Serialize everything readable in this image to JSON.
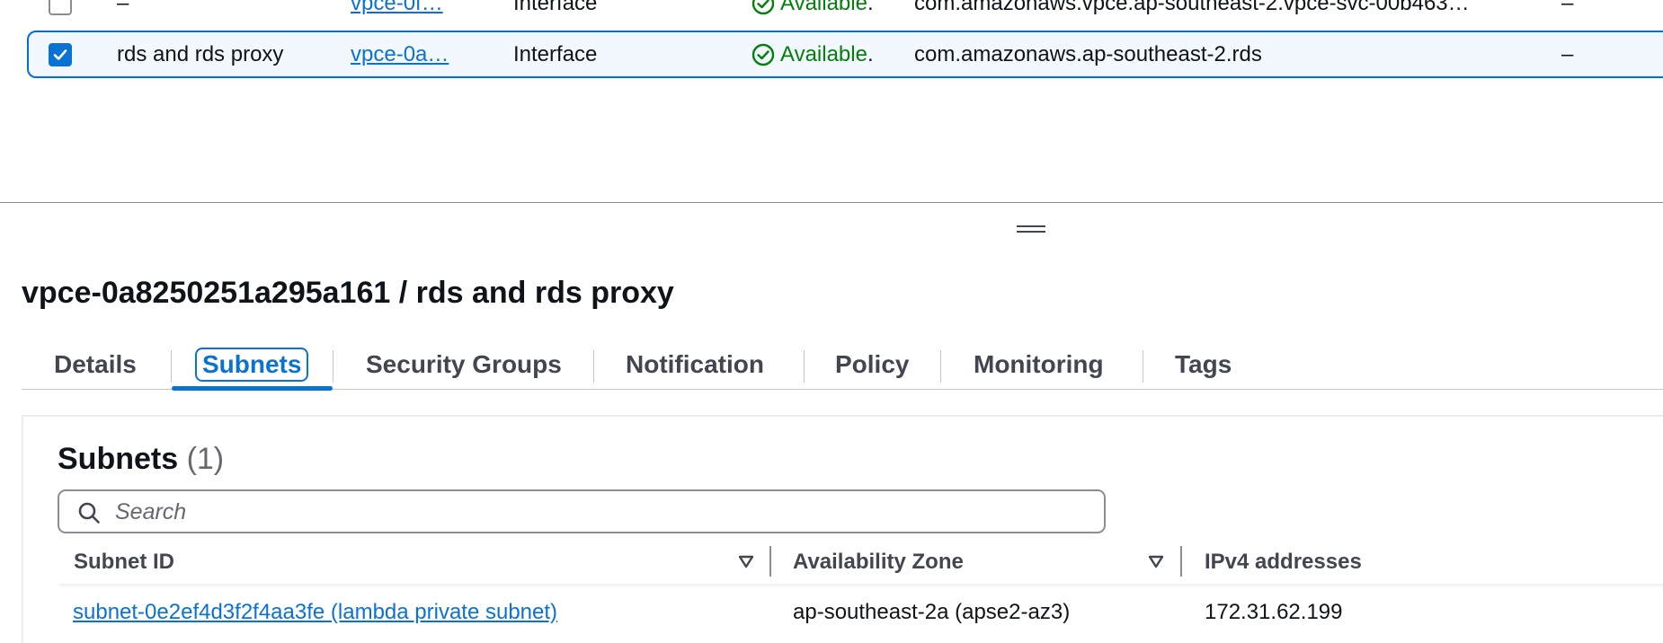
{
  "endpoints": [
    {
      "name": "–",
      "id": "vpce-0f…",
      "type": "Interface",
      "status": "Available",
      "service": "com.amazonaws.vpce.ap-southeast-2.vpce-svc-00b463…",
      "extra": "–",
      "selected": false
    },
    {
      "name": "rds and rds proxy",
      "id": "vpce-0a…",
      "type": "Interface",
      "status": "Available",
      "service": "com.amazonaws.ap-southeast-2.rds",
      "extra": "–",
      "selected": true
    }
  ],
  "status_dot": ".",
  "detail": {
    "title": "vpce-0a8250251a295a161 / rds and rds proxy",
    "tabs": [
      "Details",
      "Subnets",
      "Security Groups",
      "Notification",
      "Policy",
      "Monitoring",
      "Tags"
    ],
    "active_tab": "Subnets"
  },
  "subnets": {
    "title": "Subnets",
    "count": "(1)",
    "search_placeholder": "Search",
    "columns": [
      "Subnet ID",
      "Availability Zone",
      "IPv4 addresses"
    ],
    "rows": [
      {
        "subnet_id": "subnet-0e2ef4d3f2f4aa3fe (lambda private subnet)",
        "availability_zone": "ap-southeast-2a (apse2-az3)",
        "ipv4": "172.31.62.199"
      }
    ]
  },
  "colors": {
    "accent": "#0972d3",
    "success": "#037f0c",
    "selected_row_bg": "#f2f8fd"
  }
}
